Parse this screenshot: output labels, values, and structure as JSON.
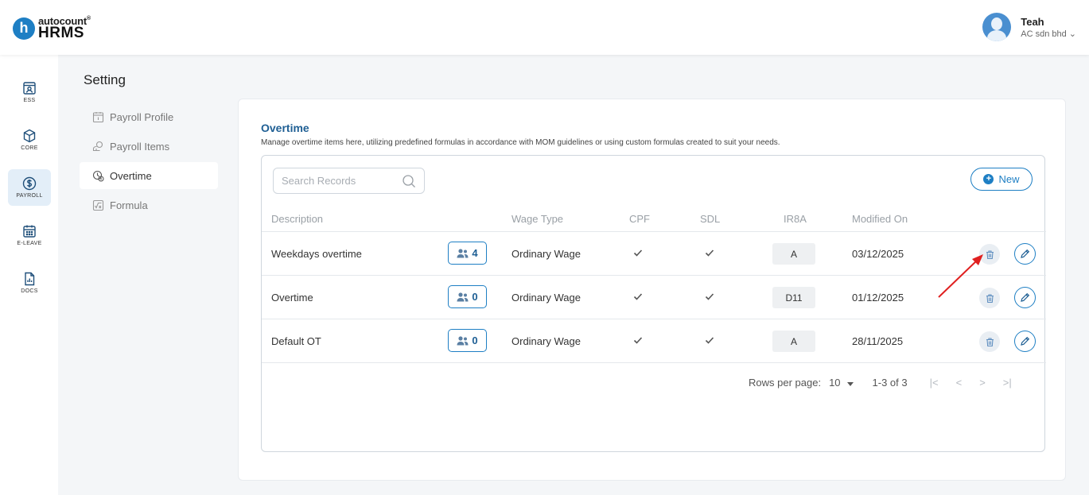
{
  "brand": {
    "badge": "h",
    "top": "autocount",
    "bottom": "HRMS"
  },
  "user": {
    "name": "Teah",
    "company": "AC sdn bhd"
  },
  "rail": [
    {
      "label": "ESS",
      "icon": "id-card-icon"
    },
    {
      "label": "CORE",
      "icon": "cube-icon"
    },
    {
      "label": "PAYROLL",
      "icon": "dollar-circle-icon",
      "active": true
    },
    {
      "label": "E-LEAVE",
      "icon": "calendar-icon"
    },
    {
      "label": "DOCS",
      "icon": "document-chart-icon"
    }
  ],
  "setting": {
    "title": "Setting",
    "nav": [
      {
        "label": "Payroll Profile",
        "icon": "calendar-icon"
      },
      {
        "label": "Payroll Items",
        "icon": "coins-icon"
      },
      {
        "label": "Overtime",
        "icon": "clock-dollar-icon",
        "active": true
      },
      {
        "label": "Formula",
        "icon": "formula-icon"
      }
    ]
  },
  "overtime": {
    "title": "Overtime",
    "description": "Manage overtime items here, utilizing predefined formulas in accordance with MOM guidelines or using custom formulas created to suit your needs.",
    "search_placeholder": "Search Records",
    "new_label": "New",
    "columns": {
      "description": "Description",
      "wage_type": "Wage Type",
      "cpf": "CPF",
      "sdl": "SDL",
      "ir8a": "IR8A",
      "modified_on": "Modified On"
    },
    "rows": [
      {
        "description": "Weekdays overtime",
        "employees": "4",
        "wage_type": "Ordinary Wage",
        "cpf": true,
        "sdl": true,
        "ir8a": "A",
        "modified_on": "03/12/2025"
      },
      {
        "description": "Overtime",
        "employees": "0",
        "wage_type": "Ordinary Wage",
        "cpf": true,
        "sdl": true,
        "ir8a": "D11",
        "modified_on": "01/12/2025"
      },
      {
        "description": "Default OT",
        "employees": "0",
        "wage_type": "Ordinary Wage",
        "cpf": true,
        "sdl": true,
        "ir8a": "A",
        "modified_on": "28/11/2025"
      }
    ],
    "pagination": {
      "rows_per_page_label": "Rows per page:",
      "rows_per_page": "10",
      "range": "1-3 of 3",
      "first": "|<",
      "prev": "<",
      "next": ">",
      "last": ">|"
    }
  },
  "colors": {
    "primary": "#1e7fc4",
    "title": "#1f5f94",
    "annotation_arrow": "#e02020"
  }
}
